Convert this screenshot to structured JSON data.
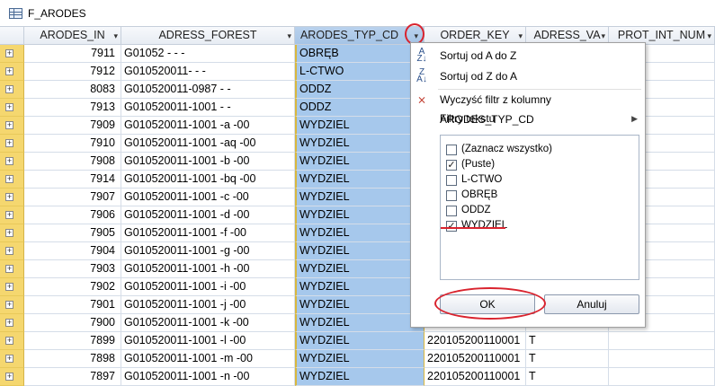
{
  "window": {
    "title": "F_ARODES"
  },
  "columns": [
    {
      "label": "ARODES_IN",
      "arrow": "▾"
    },
    {
      "label": "ADRESS_FOREST",
      "arrow": "▾"
    },
    {
      "label": "ARODES_TYP_CD",
      "arrow": "▾"
    },
    {
      "label": "ORDER_KEY",
      "arrow": "▾"
    },
    {
      "label": "ADRESS_VA",
      "arrow": "▾"
    },
    {
      "label": "PROT_INT_NUM",
      "arrow": "▾"
    }
  ],
  "rows": [
    {
      "id": "7911",
      "forest": "G01052   -   -   -",
      "typ": "OBRĘB",
      "order": "",
      "va": ""
    },
    {
      "id": "7912",
      "forest": "G010520011-   -   -",
      "typ": "L-CTWO",
      "order": "",
      "va": ""
    },
    {
      "id": "8083",
      "forest": "G010520011-0987  -   -",
      "typ": "ODDZ",
      "order": "",
      "va": ""
    },
    {
      "id": "7913",
      "forest": "G010520011-1001  -   -",
      "typ": "ODDZ",
      "order": "",
      "va": ""
    },
    {
      "id": "7909",
      "forest": "G010520011-1001  -a   -00",
      "typ": "WYDZIEL",
      "order": "",
      "va": ""
    },
    {
      "id": "7910",
      "forest": "G010520011-1001  -aq  -00",
      "typ": "WYDZIEL",
      "order": "",
      "va": ""
    },
    {
      "id": "7908",
      "forest": "G010520011-1001  -b   -00",
      "typ": "WYDZIEL",
      "order": "",
      "va": ""
    },
    {
      "id": "7914",
      "forest": "G010520011-1001  -bq  -00",
      "typ": "WYDZIEL",
      "order": "",
      "va": ""
    },
    {
      "id": "7907",
      "forest": "G010520011-1001  -c   -00",
      "typ": "WYDZIEL",
      "order": "",
      "va": ""
    },
    {
      "id": "7906",
      "forest": "G010520011-1001  -d   -00",
      "typ": "WYDZIEL",
      "order": "",
      "va": ""
    },
    {
      "id": "7905",
      "forest": "G010520011-1001  -f   -00",
      "typ": "WYDZIEL",
      "order": "",
      "va": ""
    },
    {
      "id": "7904",
      "forest": "G010520011-1001  -g   -00",
      "typ": "WYDZIEL",
      "order": "",
      "va": ""
    },
    {
      "id": "7903",
      "forest": "G010520011-1001  -h   -00",
      "typ": "WYDZIEL",
      "order": "",
      "va": ""
    },
    {
      "id": "7902",
      "forest": "G010520011-1001  -i   -00",
      "typ": "WYDZIEL",
      "order": "",
      "va": ""
    },
    {
      "id": "7901",
      "forest": "G010520011-1001  -j   -00",
      "typ": "WYDZIEL",
      "order": "",
      "va": ""
    },
    {
      "id": "7900",
      "forest": "G010520011-1001  -k   -00",
      "typ": "WYDZIEL",
      "order": "",
      "va": ""
    },
    {
      "id": "7899",
      "forest": "G010520011-1001  -l   -00",
      "typ": "WYDZIEL",
      "order": "220105200110001",
      "va": "T"
    },
    {
      "id": "7898",
      "forest": "G010520011-1001  -m   -00",
      "typ": "WYDZIEL",
      "order": "220105200110001",
      "va": "T"
    },
    {
      "id": "7897",
      "forest": "G010520011-1001  -n   -00",
      "typ": "WYDZIEL",
      "order": "220105200110001",
      "va": "T"
    }
  ],
  "filter_menu": {
    "sort_az": "Sortuj od A do Z",
    "sort_za": "Sortuj od Z do A",
    "clear_filter": "Wyczyść filtr z kolumny ARODES_TYP_CD",
    "text_filters": "Filtry tekstu",
    "options": [
      {
        "label": "(Zaznacz wszystko)",
        "checked": false
      },
      {
        "label": "(Puste)",
        "checked": true
      },
      {
        "label": "L-CTWO",
        "checked": false
      },
      {
        "label": "OBRĘB",
        "checked": false
      },
      {
        "label": "ODDZ",
        "checked": false
      },
      {
        "label": "WYDZIEL",
        "checked": true
      }
    ],
    "ok": "OK",
    "cancel": "Anuluj"
  },
  "colors": {
    "selected_column": "#a6c8ec",
    "row_selector": "#f5d76f",
    "annotation": "#d9232e"
  }
}
